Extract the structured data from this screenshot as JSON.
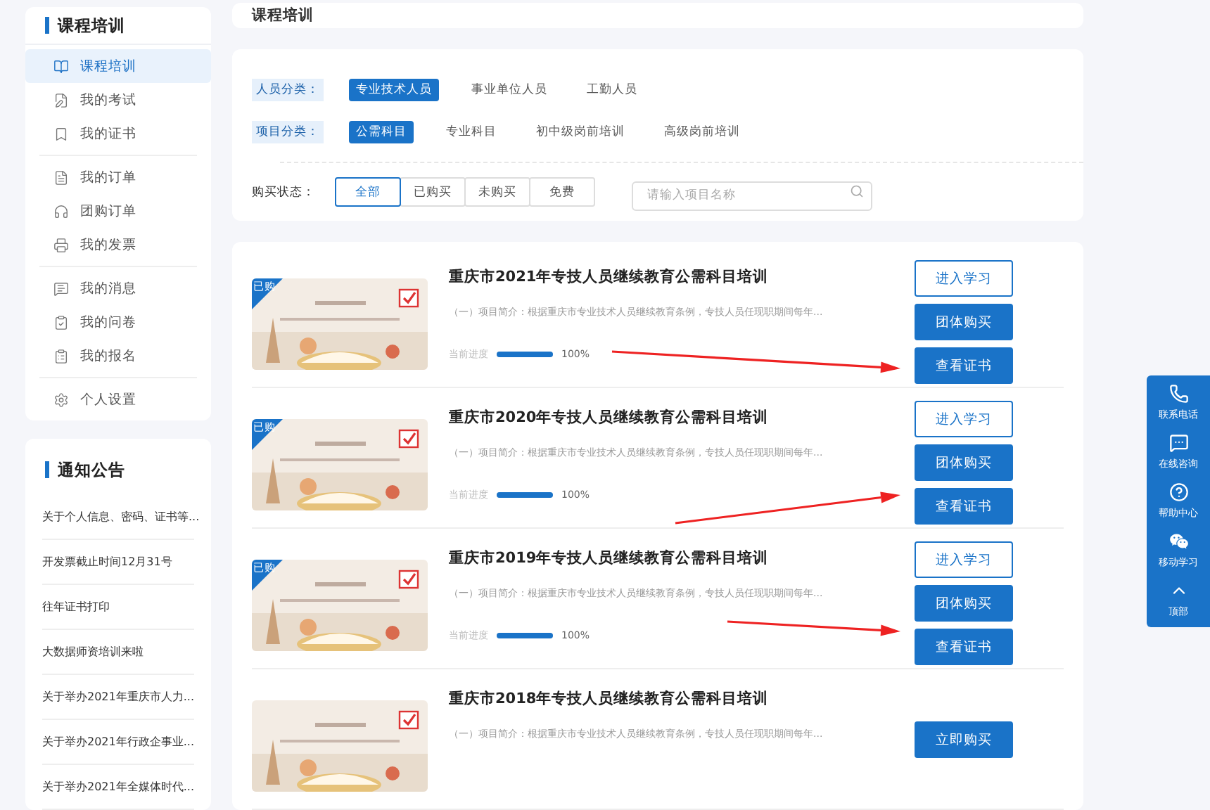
{
  "sidebar": {
    "title": "课程培训",
    "groups": [
      {
        "items": [
          {
            "label": "课程培训",
            "selected": true
          },
          {
            "label": "我的考试",
            "selected": false
          },
          {
            "label": "我的证书",
            "selected": false
          }
        ]
      },
      {
        "items": [
          {
            "label": "我的订单",
            "selected": false
          },
          {
            "label": "团购订单",
            "selected": false
          },
          {
            "label": "我的发票",
            "selected": false
          }
        ]
      },
      {
        "items": [
          {
            "label": "我的消息",
            "selected": false
          },
          {
            "label": "我的问卷",
            "selected": false
          },
          {
            "label": "我的报名",
            "selected": false
          }
        ]
      },
      {
        "items": [
          {
            "label": "个人设置",
            "selected": false
          }
        ]
      }
    ]
  },
  "notices": {
    "title": "通知公告",
    "items": [
      "关于个人信息、密码、证书等...",
      "开发票截止时间12月31号",
      "往年证书打印",
      "大数据师资培训来啦",
      "关于举办2021年重庆市人力...",
      "关于举办2021年行政企事业...",
      "关于举办2021年全媒体时代..."
    ]
  },
  "page_title": "课程培训",
  "filters": [
    {
      "label": "人员分类：",
      "options": [
        {
          "label": "专业技术人员",
          "selected": true
        },
        {
          "label": "事业单位人员",
          "selected": false
        },
        {
          "label": "工勤人员",
          "selected": false
        }
      ]
    },
    {
      "label": "项目分类：",
      "options": [
        {
          "label": "公需科目",
          "selected": true
        },
        {
          "label": "专业科目",
          "selected": false
        },
        {
          "label": "初中级岗前培训",
          "selected": false
        },
        {
          "label": "高级岗前培训",
          "selected": false
        }
      ]
    }
  ],
  "purchase_status": {
    "label": "购买状态：",
    "options": [
      {
        "label": "全部",
        "selected": true
      },
      {
        "label": "已购买",
        "selected": false
      },
      {
        "label": "未购买",
        "selected": false
      },
      {
        "label": "免费",
        "selected": false
      }
    ]
  },
  "search": {
    "placeholder": "请输入项目名称"
  },
  "courses": [
    {
      "title": "重庆市2021年专技人员继续教育公需科目培训",
      "badge": "已购",
      "intro": "（一）项目简介：根据重庆市专业技术人员继续教育条例，专技人员任现职期间每年...",
      "progress_label": "当前进度",
      "level": 1,
      "reading": "100%",
      "buttons": [
        {
          "label": "进入学习",
          "kind": "outline"
        },
        {
          "label": "团体购买",
          "kind": "solid"
        },
        {
          "label": "查看证书",
          "kind": "solid"
        }
      ]
    },
    {
      "title": "重庆市2020年专技人员继续教育公需科目培训",
      "badge": "已购",
      "intro": "（一）项目简介：根据重庆市专业技术人员继续教育条例，专技人员任现职期间每年...",
      "progress_label": "当前进度",
      "level": 1,
      "reading": "100%",
      "buttons": [
        {
          "label": "进入学习",
          "kind": "outline"
        },
        {
          "label": "团体购买",
          "kind": "solid"
        },
        {
          "label": "查看证书",
          "kind": "solid"
        }
      ]
    },
    {
      "title": "重庆市2019年专技人员继续教育公需科目培训",
      "badge": "已购",
      "intro": "（一）项目简介：根据重庆市专业技术人员继续教育条例，专技人员任现职期间每年...",
      "progress_label": "当前进度",
      "level": 1,
      "reading": "100%",
      "buttons": [
        {
          "label": "进入学习",
          "kind": "outline"
        },
        {
          "label": "团体购买",
          "kind": "solid"
        },
        {
          "label": "查看证书",
          "kind": "solid"
        }
      ]
    },
    {
      "title": "重庆市2018年专技人员继续教育公需科目培训",
      "intro": "（一）项目简介：根据重庆市专业技术人员继续教育条例，专技人员任现职期间每年...",
      "buttons": [
        {
          "label": "立即购买",
          "kind": "solid"
        }
      ]
    }
  ],
  "float_bar": [
    "联系电话",
    "在线咨询",
    "帮助中心",
    "移动学习",
    "顶部"
  ]
}
